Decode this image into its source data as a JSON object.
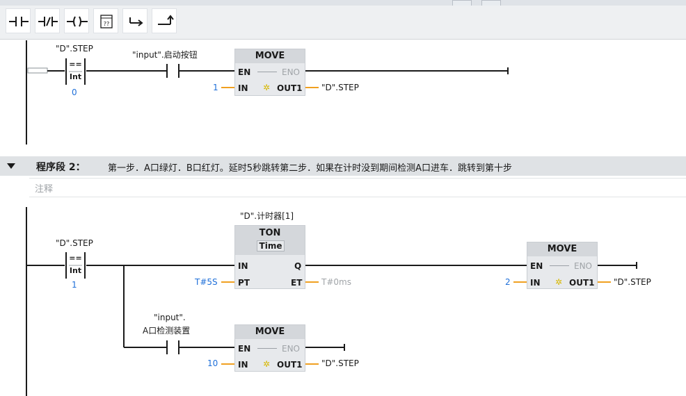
{
  "toolbar": {
    "buttons": [
      {
        "icon": "no-contact-icon"
      },
      {
        "icon": "nc-contact-icon"
      },
      {
        "icon": "coil-icon"
      },
      {
        "icon": "empty-box-icon",
        "glyph": "??"
      },
      {
        "icon": "open-branch-icon"
      },
      {
        "icon": "close-branch-icon"
      }
    ]
  },
  "network1": {
    "cmp": {
      "operand": "\"D\".STEP",
      "op": "==",
      "type": "Int",
      "value": "0"
    },
    "contact": {
      "operand": "\"input\".启动按钮"
    },
    "move": {
      "title": "MOVE",
      "en": "EN",
      "eno": "ENO",
      "in": "IN",
      "out": "OUT1",
      "in_value": "1",
      "out_operand": "\"D\".STEP"
    }
  },
  "network2": {
    "header": {
      "label": "程序段 2：",
      "title": "第一步．A口绿灯．B口红灯。延时5秒跳转第二步．如果在计时没到期间检测A口进车．跳转到第十步"
    },
    "comment_placeholder": "注释",
    "cmp": {
      "operand": "\"D\".STEP",
      "op": "==",
      "type": "Int",
      "value": "1"
    },
    "timer": {
      "instance": "\"D\".计时器[1]",
      "title": "TON",
      "subtitle": "Time",
      "in": "IN",
      "q": "Q",
      "pt": "PT",
      "et": "ET",
      "pt_value": "T#5S",
      "et_value": "T#0ms"
    },
    "move1": {
      "title": "MOVE",
      "en": "EN",
      "eno": "ENO",
      "in": "IN",
      "out": "OUT1",
      "in_value": "2",
      "out_operand": "\"D\".STEP"
    },
    "contact": {
      "operand_line1": "\"input\".",
      "operand_line2": "A口检测装置"
    },
    "move2": {
      "title": "MOVE",
      "en": "EN",
      "eno": "ENO",
      "in": "IN",
      "out": "OUT1",
      "in_value": "10",
      "out_operand": "\"D\".STEP"
    }
  }
}
